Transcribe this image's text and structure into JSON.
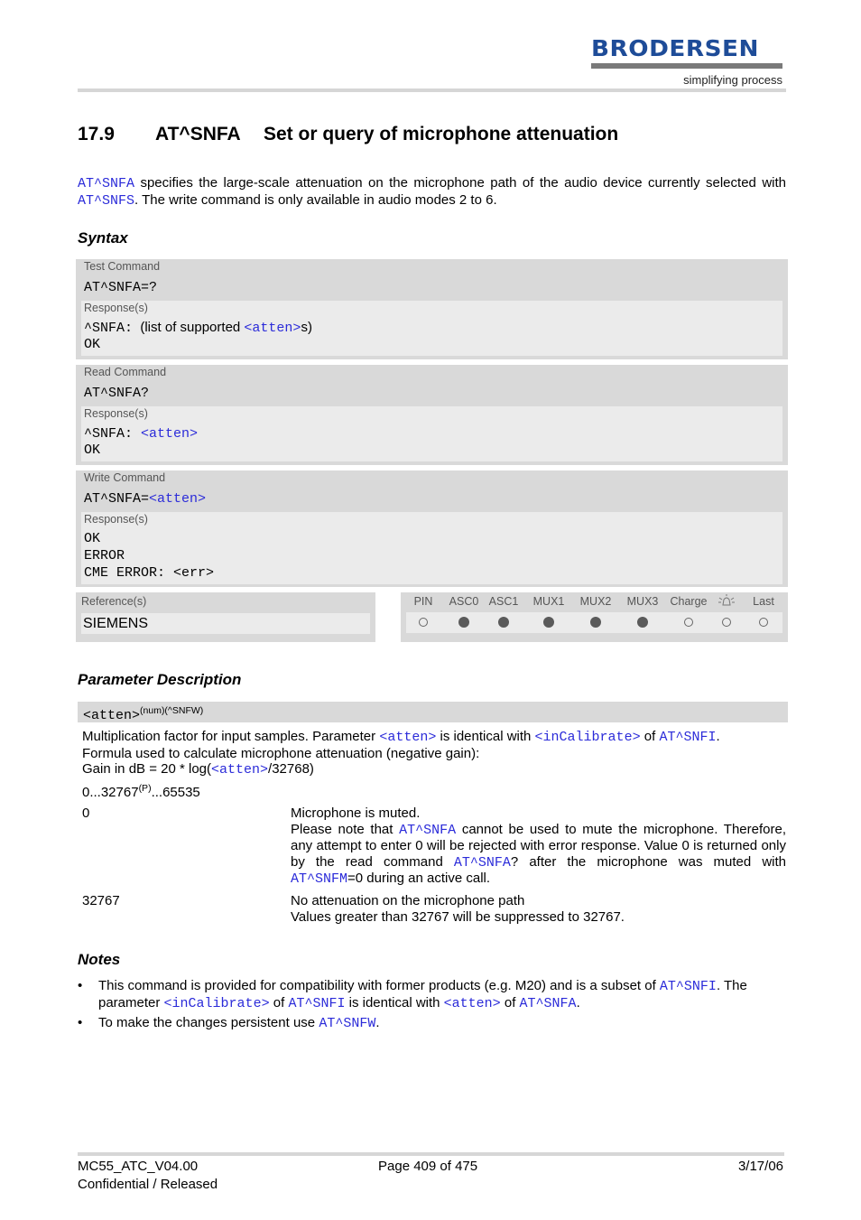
{
  "header": {
    "logo_text": "BRODERSEN",
    "tagline": "simplifying process",
    "brand_color": "#1e4c98"
  },
  "section": {
    "number": "17.9",
    "command": "AT^SNFA",
    "title": "Set or query of microphone attenuation"
  },
  "intro": {
    "link1": "AT^SNFA",
    "text1": " specifies the large-scale attenuation on the microphone path of the audio device currently selected with ",
    "link2": "AT^SNFS",
    "text2": ". The write command is only available in audio modes 2 to 6."
  },
  "syntax": {
    "heading": "Syntax",
    "test": {
      "label": "Test Command",
      "command": "AT^SNFA=?",
      "responses_label": "Response(s)",
      "resp_prefix": "^SNFA:",
      "resp_text": "(list of supported ",
      "resp_link": "<atten>",
      "resp_suffix": "s)",
      "resp_ok": "OK"
    },
    "read": {
      "label": "Read Command",
      "command": "AT^SNFA?",
      "responses_label": "Response(s)",
      "resp_prefix": "^SNFA: ",
      "resp_link": "<atten>",
      "resp_ok": "OK"
    },
    "write": {
      "label": "Write Command",
      "command_prefix": "AT^SNFA=",
      "command_link": "<atten>",
      "responses_label": "Response(s)",
      "responses": [
        "OK",
        "ERROR",
        "CME ERROR: <err>"
      ]
    },
    "reference": {
      "label": "Reference(s)",
      "value": "SIEMENS"
    },
    "availability": {
      "columns": [
        {
          "label": "PIN",
          "supported": false
        },
        {
          "label": "ASC0",
          "supported": true
        },
        {
          "label": "ASC1",
          "supported": true
        },
        {
          "label": "MUX1",
          "supported": true
        },
        {
          "label": "MUX2",
          "supported": true
        },
        {
          "label": "MUX3",
          "supported": true
        },
        {
          "label": "Charge",
          "supported": false
        },
        {
          "label": "alarm-icon",
          "supported": false
        },
        {
          "label": "Last",
          "supported": false
        }
      ]
    }
  },
  "parameters": {
    "heading": "Parameter Description",
    "name": "<atten>",
    "name_sup": "(num)(^SNFW)",
    "desc_text1": "Multiplication factor for input samples. Parameter ",
    "desc_link1": "<atten>",
    "desc_text2": " is identical with ",
    "desc_link2": "<inCalibrate>",
    "desc_text3": " of ",
    "desc_link3": "AT^SNFI",
    "desc_text4": ".",
    "desc_line2": "Formula used to calculate microphone attenuation (negative gain):",
    "desc_line3_a": "Gain in dB = 20 * log(",
    "desc_line3_link": "<atten>",
    "desc_line3_b": "/32768)",
    "range_a": "0...32767",
    "range_sup": "(P)",
    "range_b": "...65535",
    "values": [
      {
        "key": "0",
        "line1": "Microphone is muted.",
        "t1": "Please note that ",
        "l1": "AT^SNFA",
        "t2": " cannot be used to mute the microphone. Therefore, any attempt to enter 0 will be rejected with error response. Value 0 is returned only by the read command ",
        "l2": "AT^SNFA",
        "t3": "? after the microphone was muted with ",
        "l3": "AT^SNFM",
        "t4": "=0 during an active call."
      },
      {
        "key": "32767",
        "line1": "No attenuation on the microphone path",
        "line2": "Values greater than 32767 will be suppressed to 32767."
      }
    ]
  },
  "notes": {
    "heading": "Notes",
    "bullet": "•",
    "note1": {
      "t1": "This command is provided for compatibility with former products (e.g. M20) and is a subset of ",
      "l1": "AT^SNFI",
      "t2": ". The parameter ",
      "l2": "<inCalibrate>",
      "t3": " of ",
      "l3": "AT^SNFI",
      "t4": " is identical with ",
      "l4": "<atten>",
      "t5": " of ",
      "l5": "AT^SNFA",
      "t6": "."
    },
    "note2": {
      "t1": "To make the changes persistent use ",
      "l1": "AT^SNFW",
      "t2": "."
    }
  },
  "footer": {
    "doc_id": "MC55_ATC_V04.00",
    "page": "Page 409 of 475",
    "date": "3/17/06",
    "status": "Confidential / Released"
  }
}
